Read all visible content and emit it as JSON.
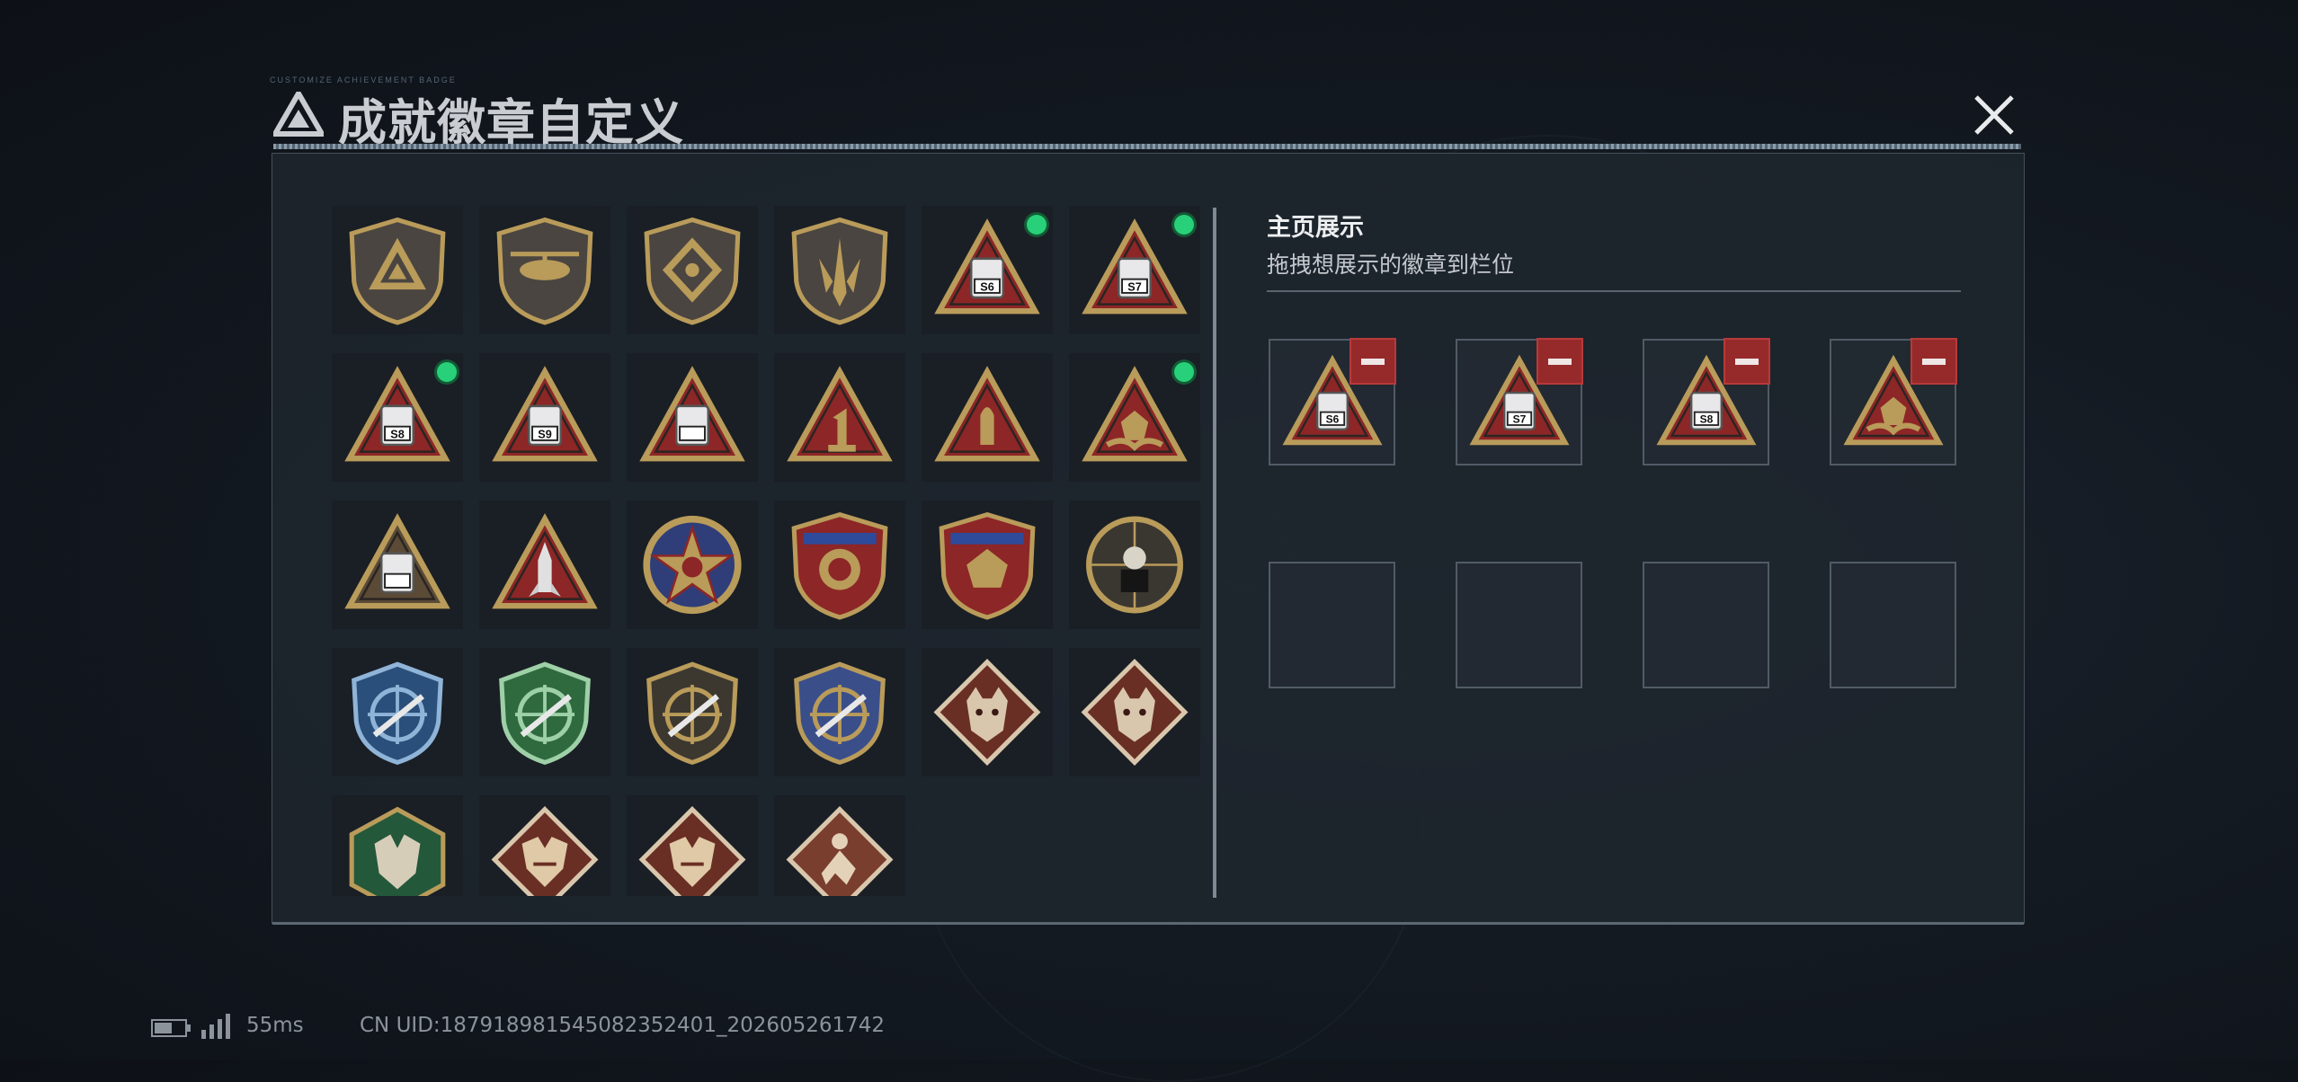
{
  "window": {
    "title": "成就徽章自定义",
    "title_tiny": "CUSTOMIZE ACHIEVEMENT BADGE"
  },
  "badges": [
    {
      "icon": "shield-triangle-emblem-icon",
      "equipped": false
    },
    {
      "icon": "shield-helicopter-icon",
      "equipped": false
    },
    {
      "icon": "shield-diamond-emblem-icon",
      "equipped": false
    },
    {
      "icon": "shield-dagger-icon",
      "equipped": false
    },
    {
      "icon": "triangle-s6-season-icon",
      "label": "S6",
      "equipped": true
    },
    {
      "icon": "triangle-s7-season-icon",
      "label": "S7",
      "equipped": true
    },
    {
      "icon": "triangle-s8-season-icon",
      "label": "S8",
      "equipped": true
    },
    {
      "icon": "triangle-s9-season-icon",
      "label": "S9",
      "equipped": false
    },
    {
      "icon": "triangle-ship-icon",
      "equipped": false
    },
    {
      "icon": "triangle-number-one-icon",
      "label": "1",
      "equipped": false
    },
    {
      "icon": "triangle-bullet-icon",
      "equipped": false
    },
    {
      "icon": "triangle-dice-hands-icon",
      "equipped": true
    },
    {
      "icon": "triangle-soldiers-icon",
      "equipped": false
    },
    {
      "icon": "triangle-rocket-icon",
      "equipped": false
    },
    {
      "icon": "round-star-skull-icon",
      "equipped": false
    },
    {
      "icon": "shield-winged-emblem-icon",
      "equipped": false
    },
    {
      "icon": "shield-dice-icon",
      "equipped": false
    },
    {
      "icon": "round-soldier-target-icon",
      "equipped": false
    },
    {
      "icon": "blue-crosshair-rifle-icon",
      "equipped": false
    },
    {
      "icon": "green-crosshair-rifle-icon",
      "equipped": false
    },
    {
      "icon": "bronze-crosshair-rifle-icon",
      "equipped": false
    },
    {
      "icon": "gold-crosshair-rifle-icon",
      "equipped": false
    },
    {
      "icon": "diamond-wolf-icon",
      "equipped": false
    },
    {
      "icon": "diamond-wolf-red-icon",
      "equipped": false
    },
    {
      "icon": "hexagon-dragon-green-icon",
      "equipped": false
    },
    {
      "icon": "diamond-dragon-icon",
      "equipped": false
    },
    {
      "icon": "diamond-dragon-alt-icon",
      "equipped": false
    },
    {
      "icon": "diamond-hunter-icon",
      "equipped": false
    }
  ],
  "showcase": {
    "title": "主页展示",
    "subtitle": "拖拽想展示的徽章到栏位",
    "slots": [
      {
        "icon": "triangle-s6-season-icon",
        "label": "S6",
        "filled": true
      },
      {
        "icon": "triangle-s7-season-icon",
        "label": "S7",
        "filled": true
      },
      {
        "icon": "triangle-s8-season-icon",
        "label": "S8",
        "filled": true
      },
      {
        "icon": "triangle-dice-hands-icon",
        "filled": true
      },
      {
        "filled": false
      },
      {
        "filled": false
      },
      {
        "filled": false
      },
      {
        "filled": false
      }
    ]
  },
  "status_bar": {
    "battery_level": 0.6,
    "ping": "55ms",
    "uid": "CN UID:18791898154508235240​1_202605261742"
  },
  "colors": {
    "accent_green": "#28d07a",
    "remove_red": "#962a2b",
    "gold": "#b99b5a",
    "crimson": "#8d2626"
  }
}
